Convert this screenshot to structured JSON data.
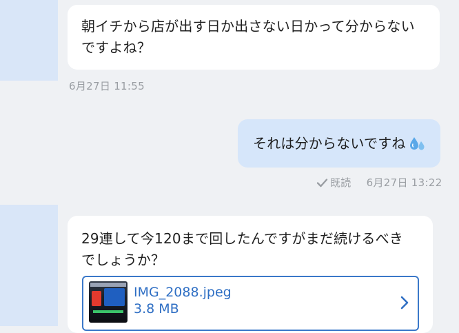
{
  "conversation": {
    "messages": [
      {
        "direction": "received",
        "text": "朝イチから店が出す日か出さない日かって分からない\nですよね？",
        "timestamp": "6月27日 11:55"
      },
      {
        "direction": "sent",
        "text": "それは分からないですね",
        "emoji_icon": "sweat-droplets-icon",
        "read_status": "既読",
        "timestamp": "6月27日 13:22"
      },
      {
        "direction": "received",
        "text": "29連して今120まで回したんですがまだ続けるべき\nでしょうか？",
        "attachment": {
          "file_name": "IMG_2088.jpeg",
          "file_size": "3.8 MB",
          "thumbnail_icon": "image-thumbnail",
          "action_icon": "chevron-right-icon"
        }
      }
    ]
  },
  "colors": {
    "background": "#eff1f4",
    "received_bubble": "#ffffff",
    "sent_bubble": "#d6e6fa",
    "avatar_placeholder": "#d9e6f8",
    "link_blue": "#2f6fc4",
    "meta_gray": "#9a9ea3"
  }
}
